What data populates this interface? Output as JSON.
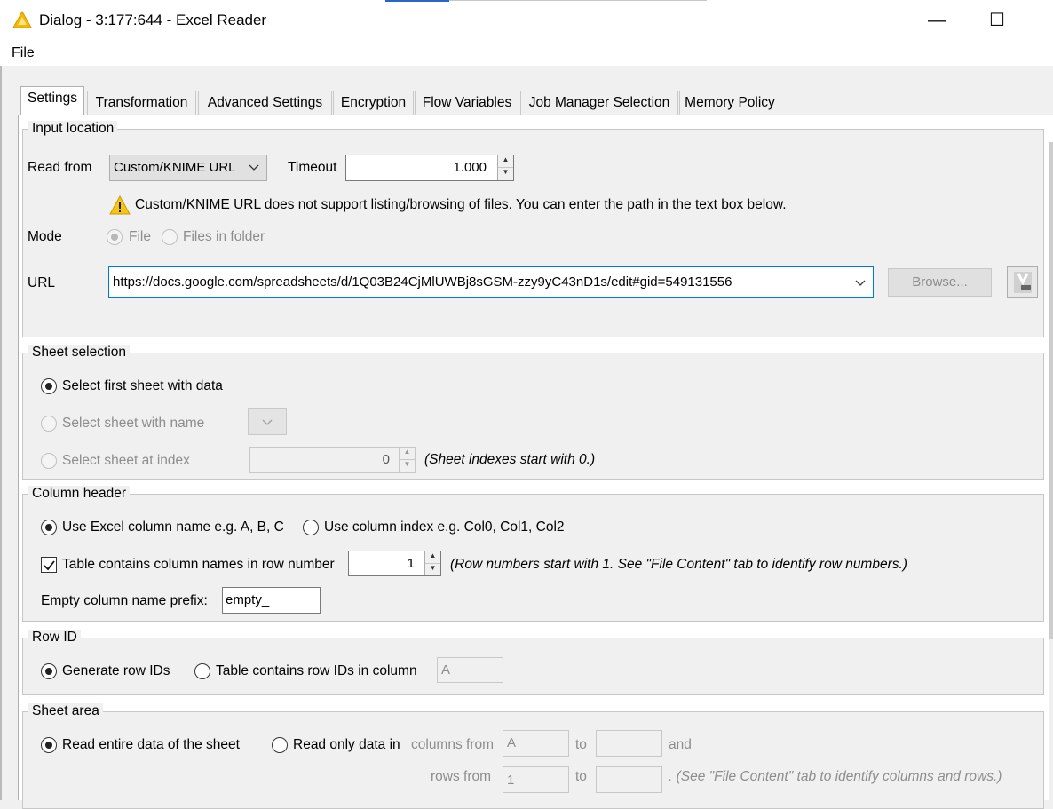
{
  "window": {
    "title": "Dialog - 3:177:644 - Excel Reader",
    "minimize": "—",
    "maximize": "☐"
  },
  "menu": {
    "file": "File"
  },
  "tabs": [
    {
      "label": "Settings",
      "active": true
    },
    {
      "label": "Transformation"
    },
    {
      "label": "Advanced Settings"
    },
    {
      "label": "Encryption"
    },
    {
      "label": "Flow Variables"
    },
    {
      "label": "Job Manager Selection"
    },
    {
      "label": "Memory Policy"
    }
  ],
  "input_location": {
    "title": "Input location",
    "read_from_label": "Read from",
    "read_from_value": "Custom/KNIME URL",
    "timeout_label": "Timeout",
    "timeout_value": "1.000",
    "warning": "Custom/KNIME URL does not support listing/browsing of files. You can enter the path in the text box below.",
    "mode_label": "Mode",
    "mode_file": "File",
    "mode_folder": "Files in folder",
    "url_label": "URL",
    "url_value": "https://docs.google.com/spreadsheets/d/1Q03B24CjMlUWBj8sGSM-zzy9yC43nD1s/edit#gid=549131556",
    "browse": "Browse..."
  },
  "sheet_selection": {
    "title": "Sheet selection",
    "first": "Select first sheet with data",
    "by_name": "Select sheet with name",
    "by_index": "Select sheet at index",
    "index_value": "0",
    "index_hint": "(Sheet indexes start with 0.)"
  },
  "column_header": {
    "title": "Column header",
    "excel_names": "Use Excel column name e.g. A, B, C",
    "index_names": "Use column index e.g. Col0, Col1, Col2",
    "contains_names": "Table contains column names in row number",
    "row_number": "1",
    "row_hint": "(Row numbers start with 1. See \"File Content\" tab to identify row numbers.)",
    "prefix_label": "Empty column name prefix:",
    "prefix_value": "empty_"
  },
  "row_id": {
    "title": "Row ID",
    "generate": "Generate row IDs",
    "in_column": "Table contains row IDs in column",
    "column_value": "A"
  },
  "sheet_area": {
    "title": "Sheet area",
    "entire": "Read entire data of the sheet",
    "only": "Read only data in",
    "columns_from": "columns from",
    "col_from_value": "A",
    "to": "to",
    "and": "and",
    "rows_from": "rows from",
    "row_from_value": "1",
    "hint": ". (See \"File Content\" tab to identify columns and rows.)"
  }
}
